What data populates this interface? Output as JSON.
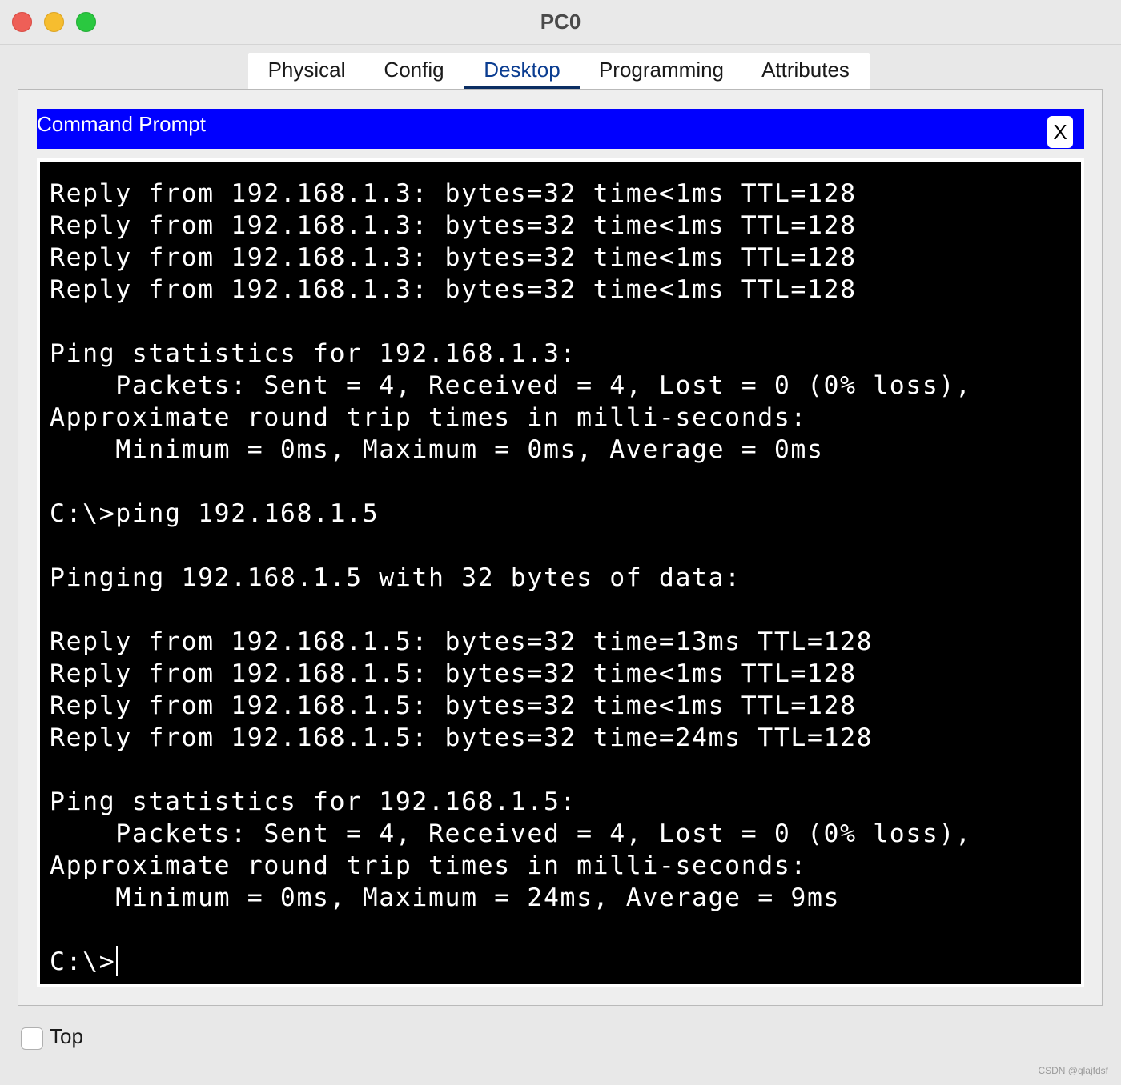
{
  "window": {
    "title": "PC0"
  },
  "tabs": [
    {
      "label": "Physical"
    },
    {
      "label": "Config"
    },
    {
      "label": "Desktop",
      "active": true
    },
    {
      "label": "Programming"
    },
    {
      "label": "Attributes"
    }
  ],
  "command_prompt": {
    "title": "Command Prompt",
    "close_label": "X",
    "header_color": "#0000ff",
    "lines": [
      "Reply from 192.168.1.3: bytes=32 time<1ms TTL=128",
      "Reply from 192.168.1.3: bytes=32 time<1ms TTL=128",
      "Reply from 192.168.1.3: bytes=32 time<1ms TTL=128",
      "Reply from 192.168.1.3: bytes=32 time<1ms TTL=128",
      "",
      "Ping statistics for 192.168.1.3:",
      "    Packets: Sent = 4, Received = 4, Lost = 0 (0% loss),",
      "Approximate round trip times in milli-seconds:",
      "    Minimum = 0ms, Maximum = 0ms, Average = 0ms",
      "",
      "C:\\>ping 192.168.1.5",
      "",
      "Pinging 192.168.1.5 with 32 bytes of data:",
      "",
      "Reply from 192.168.1.5: bytes=32 time=13ms TTL=128",
      "Reply from 192.168.1.5: bytes=32 time<1ms TTL=128",
      "Reply from 192.168.1.5: bytes=32 time<1ms TTL=128",
      "Reply from 192.168.1.5: bytes=32 time=24ms TTL=128",
      "",
      "Ping statistics for 192.168.1.5:",
      "    Packets: Sent = 4, Received = 4, Lost = 0 (0% loss),",
      "Approximate round trip times in milli-seconds:",
      "    Minimum = 0ms, Maximum = 24ms, Average = 9ms",
      ""
    ],
    "prompt": "C:\\>"
  },
  "footer": {
    "top_checkbox_label": "Top",
    "top_checked": false
  },
  "watermark": "CSDN @qlajfdsf"
}
